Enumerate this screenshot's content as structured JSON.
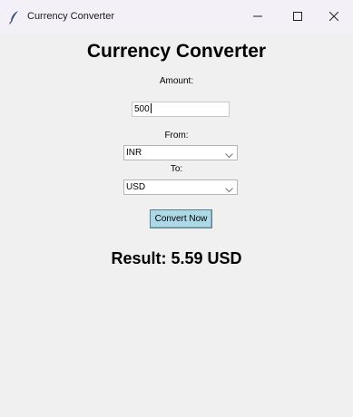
{
  "window": {
    "title": "Currency Converter",
    "icon": "feather-icon",
    "controls": [
      "minimize-icon",
      "maximize-icon",
      "close-icon"
    ]
  },
  "app": {
    "heading": "Currency Converter",
    "amount_label": "Amount:",
    "amount_value": "500",
    "from_label": "From:",
    "from_value": "INR",
    "to_label": "To:",
    "to_value": "USD",
    "convert_button": "Convert Now",
    "result": "Result: 5.59 USD"
  },
  "colors": {
    "button_bg": "#add8e6",
    "window_bg": "#f0f0f0",
    "titlebar_bg": "#f3f0f8"
  }
}
